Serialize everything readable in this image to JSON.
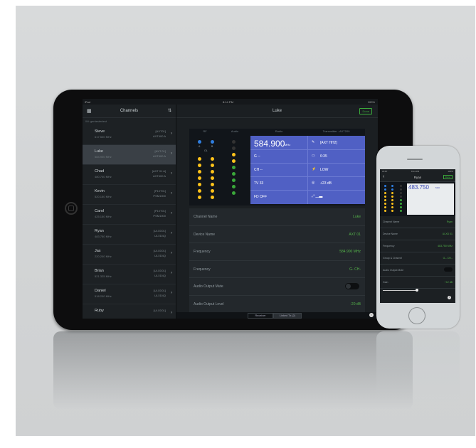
{
  "ipad": {
    "status": {
      "carrier": "iPad",
      "time": "8:14 PM",
      "battery": "100%"
    },
    "sidebar": {
      "title": "Channels",
      "subtitle": "Wi: gentestertest",
      "channels": [
        {
          "name": "Steve",
          "freq": "617.500 MHz",
          "device": "[AXT01]",
          "model": "AXT400 A"
        },
        {
          "name": "Luke",
          "freq": "584.900 MHz",
          "device": "[AXT 01]",
          "model": "AXT400 A"
        },
        {
          "name": "Chad",
          "freq": "480.700 MHz",
          "device": "[AXT 01 A]",
          "model": "AXT400 A"
        },
        {
          "name": "Kevin",
          "freq": "520.150 MHz",
          "device": "[P10T01]",
          "model": "PSM1000"
        },
        {
          "name": "Carol",
          "freq": "425.150 MHz",
          "device": "[P10T01]",
          "model": "PSM1000"
        },
        {
          "name": "Ryan",
          "freq": "483.750 MHz",
          "device": "[ULXD01]",
          "model": "ULXD4Q"
        },
        {
          "name": "Jas",
          "freq": "220.200 MHz",
          "device": "[ULXD01]",
          "model": "ULXD4Q"
        },
        {
          "name": "Brian",
          "freq": "521.325 MHz",
          "device": "[ULXD01]",
          "model": "ULXD4Q"
        },
        {
          "name": "Daniel",
          "freq": "518.200 MHz",
          "device": "[ULXD01]",
          "model": "ULXD4Q"
        },
        {
          "name": "Ruby",
          "freq": "",
          "device": "[ULXD01]",
          "model": ""
        }
      ]
    },
    "detail": {
      "title": "Luke",
      "done_label": "Done",
      "panel_headers": {
        "rf": "RF",
        "audio": "Audio",
        "radio": "Radio",
        "transmitter": "Transmitter - AXT200"
      },
      "rf_labels": {
        "a": "A",
        "b": "B",
        "ol": "OL"
      },
      "radio": {
        "freq": "584.900",
        "unit": "MHz",
        "g": "G  --",
        "ch": "CH  --",
        "tv": "TV  33",
        "fd": "FD  OFF"
      },
      "transmitter": {
        "name": "[AXT HH2]",
        "time": "6:35",
        "power": "LOW",
        "gain": "+23 dB"
      },
      "rows": [
        {
          "label": "Channel Name",
          "value": "Luke"
        },
        {
          "label": "Device Name",
          "value": "AXT 01"
        },
        {
          "label": "Frequency",
          "value": "584.900 MHz"
        },
        {
          "label": "Frequency",
          "value": "G-  CH-"
        },
        {
          "label": "Audio Output Mute",
          "value": ""
        },
        {
          "label": "Audio Output Level",
          "value": "-20 dB"
        }
      ],
      "tabs": {
        "receiver": "Receiver",
        "linked": "Linked Tx (2)"
      }
    }
  },
  "iphone": {
    "status": {
      "carrier": "AT&T",
      "time": "8:14 PM",
      "battery": "100%"
    },
    "title": "Ryan",
    "done_label": "Done",
    "freq": "483.750",
    "unit": "MHz",
    "rows": [
      {
        "label": "Channel Name",
        "value": "Ryan"
      },
      {
        "label": "Device Name",
        "value": "ULXD 01"
      },
      {
        "label": "Frequency",
        "value": "483.750 MHz"
      },
      {
        "label": "Group & Channel",
        "value": "G-- CH--"
      },
      {
        "label": "Audio Output Mute",
        "value": ""
      },
      {
        "label": "Gain",
        "value": "+12 dB"
      }
    ]
  },
  "colors": {
    "accent_green": "#54b24a",
    "radio_blue": "#5060c4",
    "led_yellow": "#ffc31a",
    "led_blue": "#2f7ee0"
  }
}
